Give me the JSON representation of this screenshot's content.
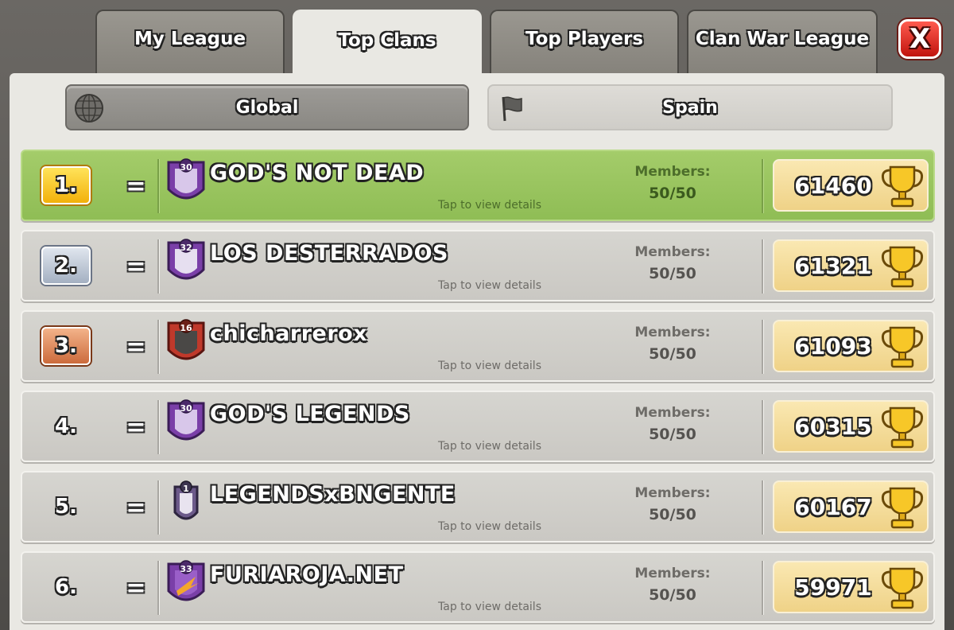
{
  "tabs": [
    {
      "label": "My League"
    },
    {
      "label": "Top Clans"
    },
    {
      "label": "Top Players"
    },
    {
      "label": "Clan War League"
    }
  ],
  "close_label": "X",
  "filters": {
    "global_label": "Global",
    "spain_label": "Spain"
  },
  "row_labels": {
    "members_label": "Members:",
    "tap_hint": "Tap to view details"
  },
  "clans": [
    {
      "rank": "1.",
      "change": "=",
      "badge_level": "30",
      "name": "GOD'S NOT DEAD",
      "members": "50/50",
      "trophies": "61460"
    },
    {
      "rank": "2.",
      "change": "=",
      "badge_level": "32",
      "name": "LOS DESTERRADOS",
      "members": "50/50",
      "trophies": "61321"
    },
    {
      "rank": "3.",
      "change": "=",
      "badge_level": "16",
      "name": "chicharrerox",
      "members": "50/50",
      "trophies": "61093"
    },
    {
      "rank": "4.",
      "change": "=",
      "badge_level": "30",
      "name": "GOD'S LEGENDS",
      "members": "50/50",
      "trophies": "60315"
    },
    {
      "rank": "5.",
      "change": "=",
      "badge_level": "1",
      "name": "LEGENDSxBNGENTE",
      "members": "50/50",
      "trophies": "60167"
    },
    {
      "rank": "6.",
      "change": "=",
      "badge_level": "33",
      "name": "FURIAROJA.NET",
      "members": "50/50",
      "trophies": "59971"
    }
  ],
  "colors": {
    "first_row": "#9cc664",
    "row": "#d1d0cb",
    "gold_rank": "#f5c21c",
    "silver_rank": "#b9c3d2",
    "bronze_rank": "#df8a5d",
    "close_button": "#e2291f"
  },
  "icons": {
    "global": "globe-icon",
    "spain": "flag-icon",
    "trophy": "trophy-icon",
    "clan_badge": "shield-badge-icon"
  }
}
